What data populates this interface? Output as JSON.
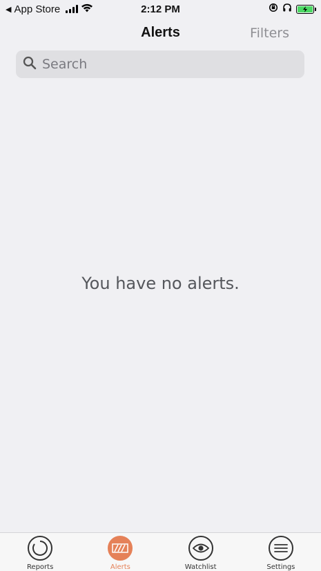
{
  "status_bar": {
    "back_arrow": "◀",
    "carrier": "App Store",
    "time": "2:12 PM"
  },
  "nav": {
    "title": "Alerts",
    "filters_label": "Filters"
  },
  "search": {
    "placeholder": "Search",
    "value": ""
  },
  "empty_state": {
    "message": "You have no alerts."
  },
  "tabs": [
    {
      "label": "Reports",
      "icon": "reports-icon",
      "active": false
    },
    {
      "label": "Alerts",
      "icon": "alerts-icon",
      "active": true
    },
    {
      "label": "Watchlist",
      "icon": "eye-icon",
      "active": false
    },
    {
      "label": "Settings",
      "icon": "menu-icon",
      "active": false
    }
  ],
  "colors": {
    "accent": "#e58158",
    "background": "#f0f0f3",
    "battery": "#4cd964"
  }
}
